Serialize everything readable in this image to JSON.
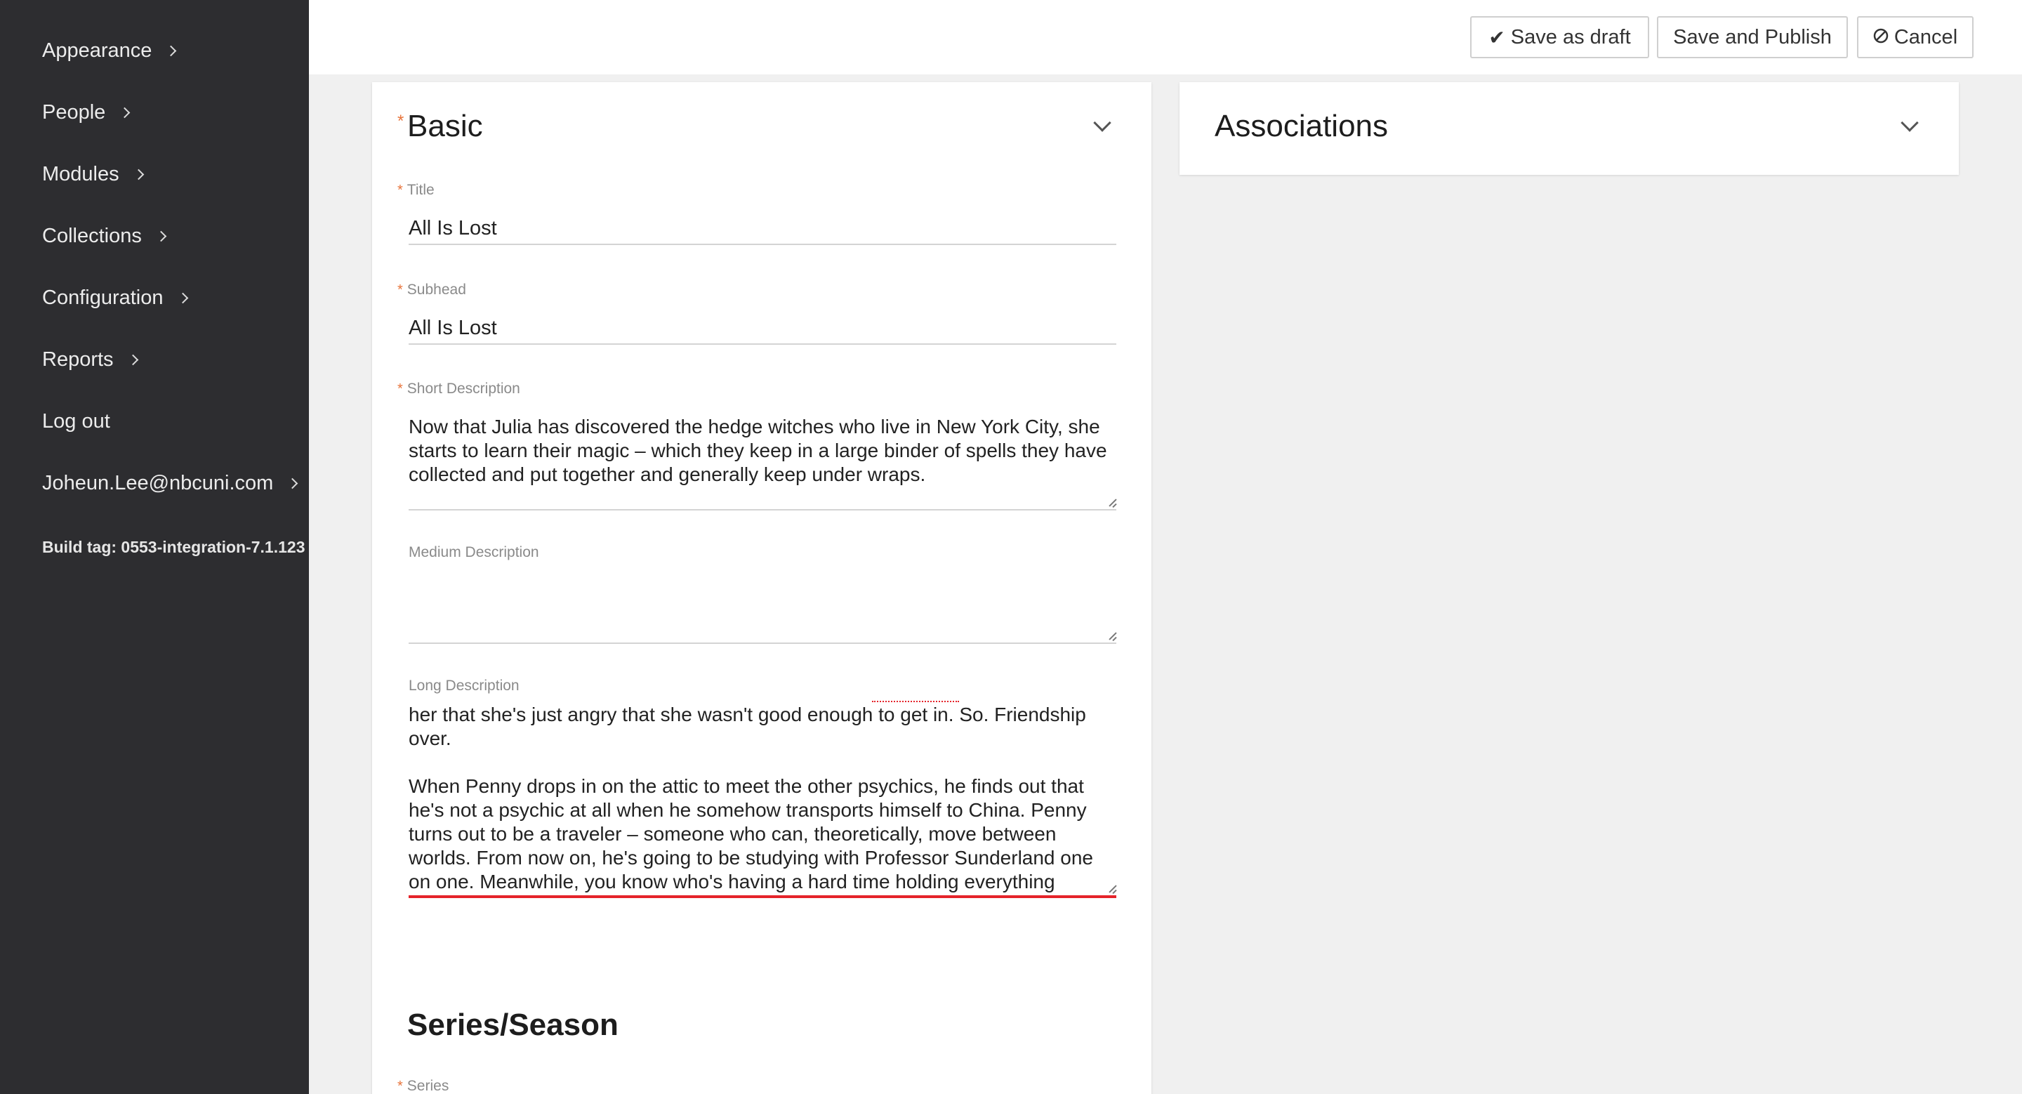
{
  "sidebar": {
    "items": [
      {
        "label": "Appearance"
      },
      {
        "label": "People"
      },
      {
        "label": "Modules"
      },
      {
        "label": "Collections"
      },
      {
        "label": "Configuration"
      },
      {
        "label": "Reports"
      },
      {
        "label": "Log out"
      },
      {
        "label": "Joheun.Lee@nbcuni.com"
      }
    ],
    "build_tag": "Build tag: 0553-integration-7.1.123"
  },
  "toolbar": {
    "save_draft_label": "Save as draft",
    "save_publish_label": "Save and Publish",
    "cancel_label": "Cancel"
  },
  "basic": {
    "title": "Basic",
    "fields": {
      "title": {
        "label": "Title",
        "value": "All Is Lost"
      },
      "subhead": {
        "label": "Subhead",
        "value": "All Is Lost"
      },
      "short_description": {
        "label": "Short Description",
        "value": "Now that Julia has discovered the hedge witches who live in New York City, she starts to learn their magic – which they keep in a large binder of spells they have collected and put together and generally keep under wraps."
      },
      "medium_description": {
        "label": "Medium Description",
        "value": ""
      },
      "long_description": {
        "label": "Long Description",
        "value": "her that she's just angry that she wasn't good enough to get in. So. Friendship over.\n\nWhen Penny drops in on the attic to meet the other psychics, he finds out that he's not a psychic at all when he somehow transports himself to China. Penny turns out to be a traveler – someone who can, theoretically, move between worlds. From now on, he's going to be studying with Professor Sunderland one on one. Meanwhile, you know who's having a hard time holding everything together? Julia. All the hedge witches tell her that she has to manager her personal life. So she lies and tells James that she's on drugs as an excuse for her weird behavior lately."
      }
    },
    "series_season": {
      "title": "Series/Season",
      "series_label": "Series"
    }
  },
  "associations": {
    "title": "Associations"
  },
  "colors": {
    "sidebar_bg": "#2d2d30",
    "required_star": "#e8743b",
    "error_underline": "#e5232a"
  }
}
